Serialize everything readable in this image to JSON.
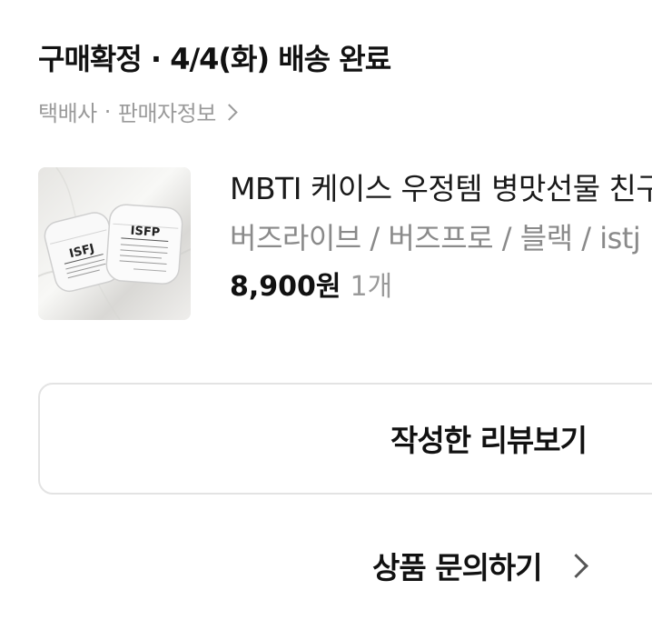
{
  "order": {
    "status": "구매확정 · 4/4(화) 배송 완료"
  },
  "delivery": {
    "courier_label": "택배사",
    "separator": "·",
    "seller_info_label": "판매자정보",
    "chevron_icon": "chevron-right-icon"
  },
  "product": {
    "thumbnail_label_left": "ISFJ",
    "thumbnail_label_right": "ISFP",
    "name": "MBTI 케이스 우정템 병맛선물 친구",
    "option": "버즈라이브 / 버즈프로 / 블랙 / istj",
    "price": "8,900원",
    "quantity": "1개"
  },
  "actions": {
    "review_button_label": "작성한 리뷰보기",
    "inquiry_label": "상품 문의하기",
    "inquiry_icon": "chevron-right-icon"
  }
}
